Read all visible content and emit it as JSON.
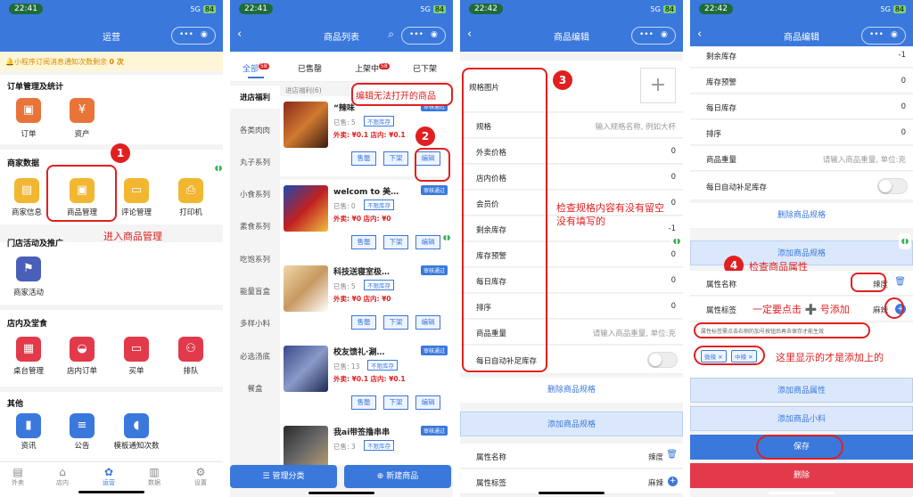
{
  "status": {
    "p1_time": "22:41",
    "p2_time": "22:41",
    "p3_time": "22:42",
    "p4_time": "22:42",
    "signal": "5G",
    "battery": "84"
  },
  "p1": {
    "title": "运营",
    "notice": "小程序订阅消息通知次数剩余",
    "notice_count": "0 次",
    "sec_orders": "订单管理及统计",
    "order_items": [
      "订单",
      "资产"
    ],
    "sec_merchant": "商家数据",
    "merchant_items": [
      "商家信息",
      "商品管理",
      "评论管理",
      "打印机"
    ],
    "sec_store": "门店活动及推广",
    "store_items": [
      "商家活动"
    ],
    "sec_dine": "店内及堂食",
    "dine_items": [
      "桌台管理",
      "店内订单",
      "买单",
      "排队"
    ],
    "sec_other": "其他",
    "other_items": [
      "资讯",
      "公告",
      "模板通知次数"
    ],
    "annotation": "进入商品管理",
    "bottom_nav": [
      "外卖",
      "店内",
      "运营",
      "数据",
      "设置"
    ]
  },
  "p2": {
    "title": "商品列表",
    "tabs": [
      "全部",
      "已售罄",
      "上架中",
      "已下架"
    ],
    "tab_badges": [
      "58",
      "",
      "58",
      ""
    ],
    "categories": [
      "进店福利",
      "各类肉肉",
      "丸子系列",
      "小食系列",
      "素食系列",
      "吃饱系列",
      "能量盲盒",
      "多样小料",
      "必选汤底",
      "餐盒"
    ],
    "group_header": "进店福利(6)",
    "products": [
      {
        "name": "“辣味",
        "badge": "审核通过",
        "sold": "已售: 5",
        "tag": "不限库存",
        "price_out": "外卖: ¥0.1",
        "price_in": "店内: ¥0.1"
      },
      {
        "name": "welcom to 美…",
        "badge": "审核通过",
        "sold": "已售: 0",
        "tag": "不限库存",
        "price_out": "外卖: ¥0",
        "price_in": "店内: ¥0"
      },
      {
        "name": "科技送寝室极…",
        "badge": "审核通过",
        "sold": "已售: 5",
        "tag": "不限库存",
        "price_out": "外卖: ¥0",
        "price_in": "店内: ¥0"
      },
      {
        "name": "校友馈礼·涮…",
        "badge": "审核通过",
        "sold": "已售: 13",
        "tag": "不限库存",
        "price_out": "外卖: ¥0.1",
        "price_in": "店内: ¥0.1"
      },
      {
        "name": "我ai带签撸串串",
        "badge": "审核通过",
        "sold": "已售: 3",
        "tag": "不限库存",
        "price_out": "",
        "price_in": ""
      }
    ],
    "btn_soldout": "售罄",
    "btn_off": "下架",
    "btn_edit": "编辑",
    "annotation": "编辑无法打开的商品",
    "manage_cat": "管理分类",
    "new_product": "新建商品"
  },
  "p3": {
    "title": "商品编辑",
    "rows": [
      {
        "k": "规格图片",
        "v": ""
      },
      {
        "k": "规格",
        "v": "输入规格名称, 例如大杯"
      },
      {
        "k": "外卖价格",
        "v": "0"
      },
      {
        "k": "店内价格",
        "v": "0"
      },
      {
        "k": "会员价",
        "v": "0"
      },
      {
        "k": "剩余库存",
        "v": "-1"
      },
      {
        "k": "库存预警",
        "v": "0"
      },
      {
        "k": "每日库存",
        "v": "0"
      },
      {
        "k": "排序",
        "v": "0"
      },
      {
        "k": "商品重量",
        "v": "请输入商品重量, 单位:克"
      },
      {
        "k": "每日自动补足库存",
        "v": ""
      }
    ],
    "annotation": "检查规格内容有没有留空没有填写的",
    "delete_spec": "删除商品规格",
    "add_spec": "添加商品规格",
    "attr_name_k": "属性名称",
    "attr_name_v": "辣度",
    "attr_tag_k": "属性标签",
    "attr_tag_v": "麻辣"
  },
  "p4": {
    "title": "商品编辑",
    "rows": [
      {
        "k": "剩余库存",
        "v": "-1"
      },
      {
        "k": "库存预警",
        "v": "0"
      },
      {
        "k": "每日库存",
        "v": "0"
      },
      {
        "k": "排序",
        "v": "0"
      },
      {
        "k": "商品重量",
        "v": "请输入商品重量, 单位:克"
      },
      {
        "k": "每日自动补足库存",
        "v": ""
      }
    ],
    "delete_spec": "删除商品规格",
    "add_spec": "添加商品规格",
    "annotation_title": "检查商品属性",
    "attr_name_k": "属性名称",
    "attr_name_v": "辣度",
    "attr_tag_k": "属性标签",
    "attr_tag_v": "麻辣",
    "annotation_plus": "一定要点击 ➕ 号添加",
    "hint": "属性标签需点击右侧的加号按钮后再去保存才能生效",
    "chips": [
      "微辣",
      "中辣"
    ],
    "annotation_chips": "这里显示的才是添加上的",
    "add_attr": "添加商品属性",
    "add_extra": "添加商品小料",
    "save": "保存",
    "delete": "删除"
  },
  "colors": {
    "primary": "#3a78dc",
    "annotation": "#e02020"
  }
}
